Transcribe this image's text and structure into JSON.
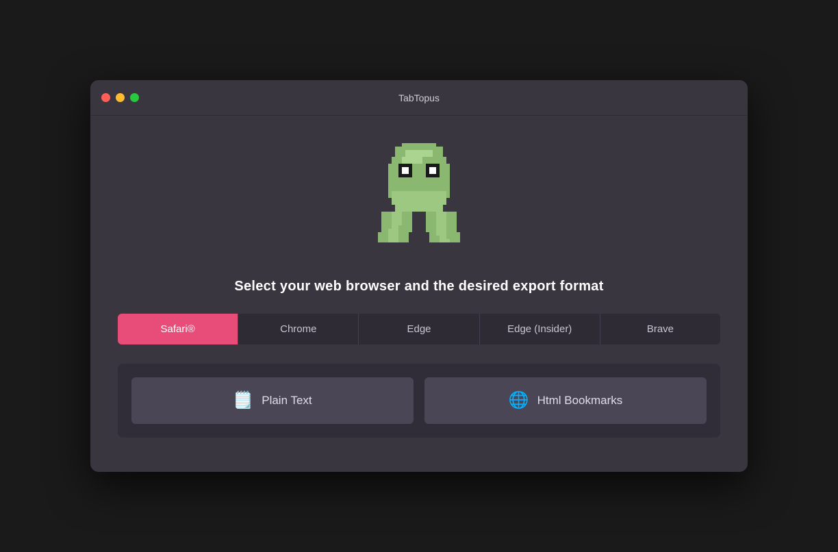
{
  "window": {
    "title": "TabTopus",
    "controls": {
      "close": "close",
      "minimize": "minimize",
      "maximize": "maximize"
    }
  },
  "main": {
    "subtitle": "Select your web browser and the desired export format",
    "browsers": [
      {
        "id": "safari",
        "label": "Safari®",
        "active": true
      },
      {
        "id": "chrome",
        "label": "Chrome",
        "active": false
      },
      {
        "id": "edge",
        "label": "Edge",
        "active": false
      },
      {
        "id": "edge-insider",
        "label": "Edge (Insider)",
        "active": false
      },
      {
        "id": "brave",
        "label": "Brave",
        "active": false
      }
    ],
    "export_formats": [
      {
        "id": "plain-text",
        "label": "Plain Text",
        "icon": "📄"
      },
      {
        "id": "html-bookmarks",
        "label": "Html Bookmarks",
        "icon": "🌐"
      }
    ]
  },
  "colors": {
    "active_tab": "#e84d7a",
    "window_bg": "#3a3640",
    "panel_bg": "#302d38"
  }
}
